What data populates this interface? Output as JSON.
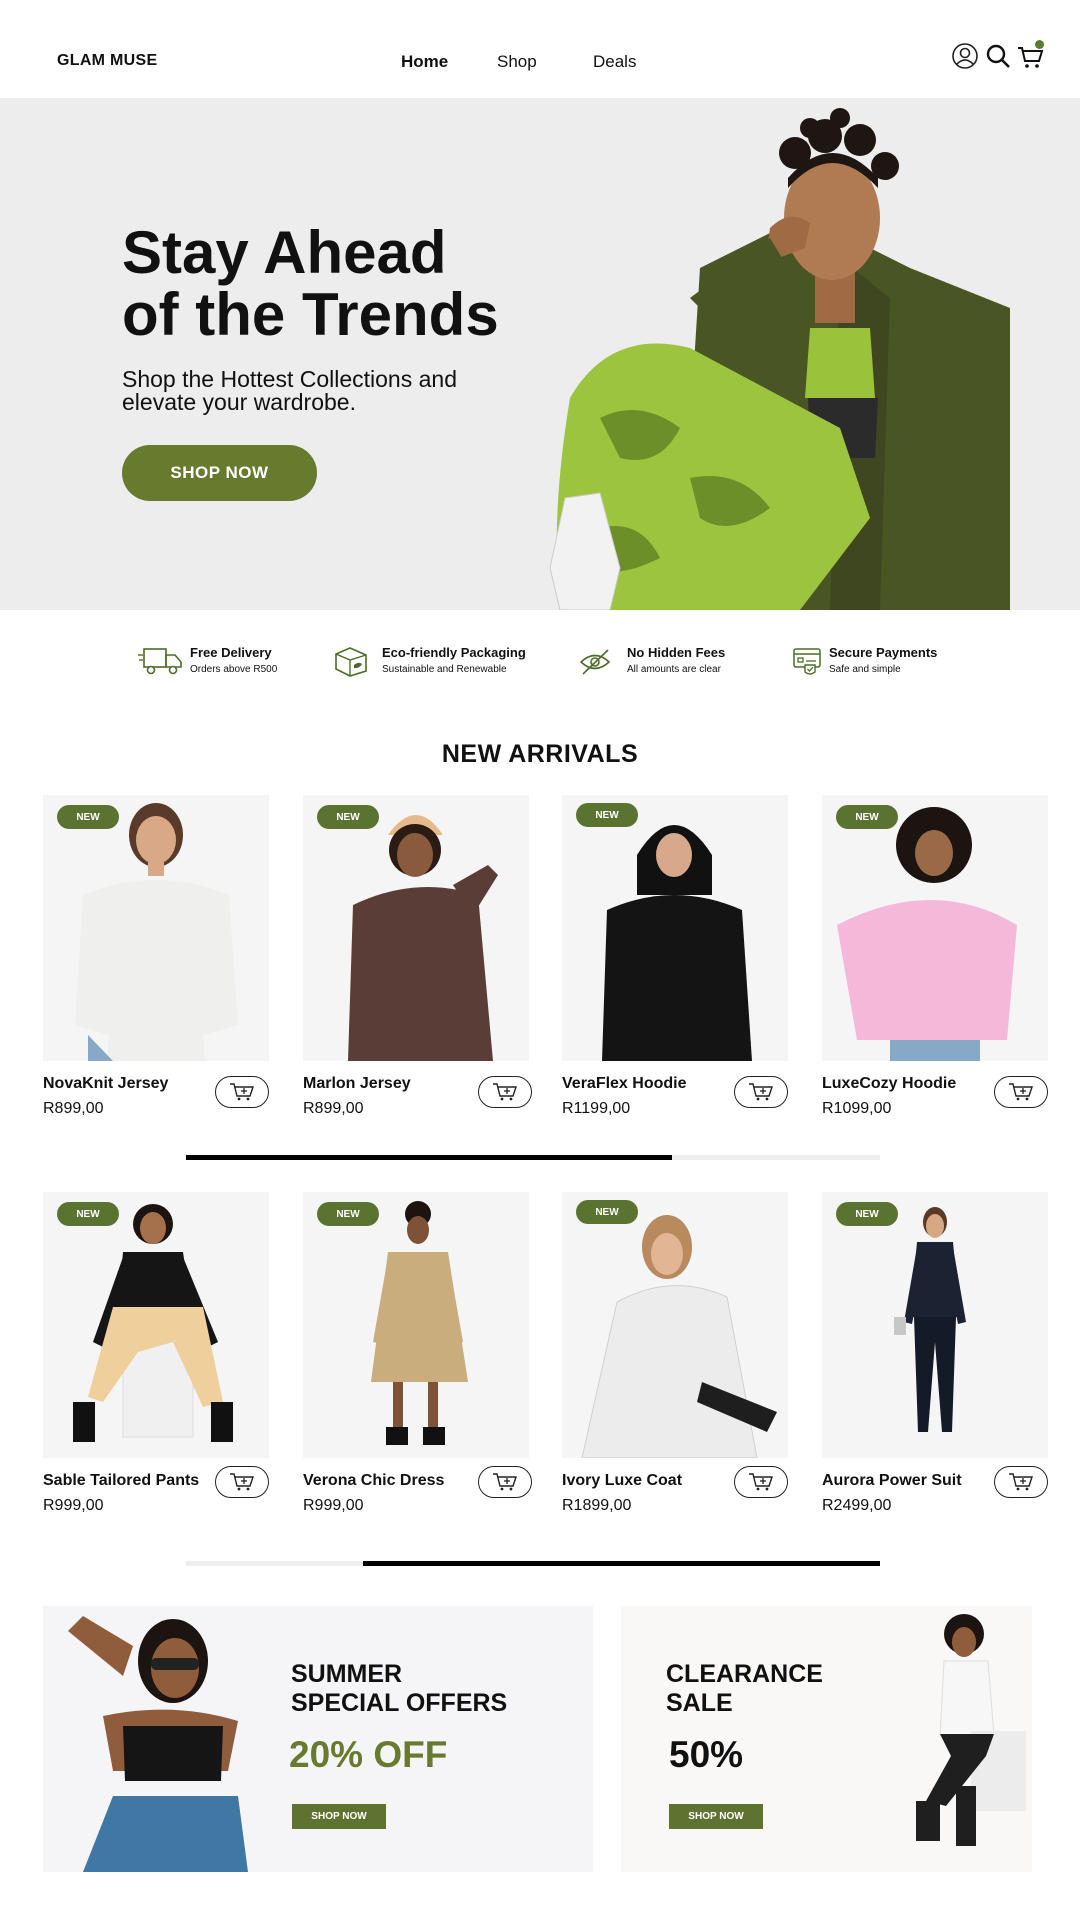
{
  "header": {
    "logo": "GLAM MUSE",
    "nav": [
      "Home",
      "Shop",
      "Deals"
    ],
    "icons": [
      "user-icon",
      "search-icon",
      "cart-icon"
    ]
  },
  "hero": {
    "title_line1": "Stay Ahead",
    "title_line2": "of the Trends",
    "subtitle_line1": "Shop the Hottest Collections and",
    "subtitle_line2": "elevate your wardrobe.",
    "cta": "SHOP NOW"
  },
  "features": [
    {
      "title": "Free Delivery",
      "subtitle": "Orders above R500",
      "icon": "truck-icon"
    },
    {
      "title": "Eco-friendly Packaging",
      "subtitle": "Sustainable and Renewable",
      "icon": "eco-box-icon"
    },
    {
      "title": "No Hidden Fees",
      "subtitle": "All amounts are clear",
      "icon": "eye-slash-icon"
    },
    {
      "title": "Secure Payments",
      "subtitle": "Safe and simple",
      "icon": "secure-card-icon"
    }
  ],
  "new_arrivals": {
    "title": "NEW ARRIVALS",
    "badge": "NEW",
    "products_row1": [
      {
        "name": "NovaKnit Jersey",
        "price": "R899,00"
      },
      {
        "name": "Marlon Jersey",
        "price": "R899,00"
      },
      {
        "name": "VeraFlex Hoodie",
        "price": "R1199,00"
      },
      {
        "name": "LuxeCozy Hoodie",
        "price": "R1099,00"
      }
    ],
    "products_row2": [
      {
        "name": "Sable Tailored Pants",
        "price": "R999,00"
      },
      {
        "name": "Verona Chic Dress",
        "price": "R999,00"
      },
      {
        "name": "Ivory Luxe Coat",
        "price": "R1899,00"
      },
      {
        "name": "Aurora Power Suit",
        "price": "R2499,00"
      }
    ]
  },
  "promos": {
    "summer": {
      "title_line1": "SUMMER",
      "title_line2": "SPECIAL OFFERS",
      "big": "20% OFF",
      "cta": "SHOP NOW"
    },
    "clearance": {
      "title_line1": "CLEARANCE",
      "title_line2": "SALE",
      "big": "50%",
      "cta": "SHOP NOW"
    }
  },
  "colors": {
    "accent": "#677a2e",
    "badge": "#5b7330",
    "hero_bg": "#ededed",
    "card_bg": "#f5f5f5"
  }
}
